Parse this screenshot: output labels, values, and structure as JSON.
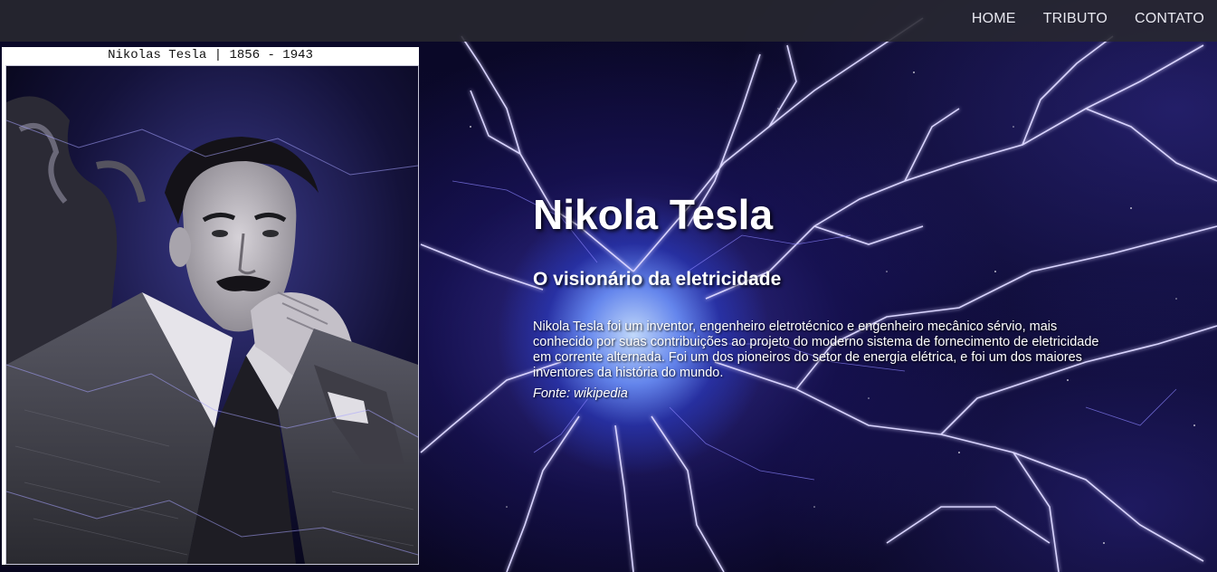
{
  "nav": {
    "items": [
      {
        "label": "HOME"
      },
      {
        "label": "TRIBUTO"
      },
      {
        "label": "CONTATO"
      }
    ]
  },
  "portrait": {
    "caption": "Nikolas Tesla | 1856 - 1943"
  },
  "hero": {
    "title": "Nikola Tesla",
    "subtitle": "O visionário da eletricidade",
    "description": "Nikola Tesla foi um inventor, engenheiro eletrotécnico e engenheiro mecânico sérvio, mais conhecido por suas contribuições ao projeto do moderno sistema de fornecimento de eletricidade em corrente alternada. Foi um dos pioneiros do setor de energia elétrica, e foi um dos maiores inventores da história do mundo.",
    "source": "Fonte: wikipedia"
  },
  "colors": {
    "nav_background": "#28282f",
    "text": "#ffffff",
    "lightning": "#c9c4ff",
    "plasma_core": "#9db8ff"
  },
  "icons": {
    "background": "plasma-lightning-image",
    "portrait": "tesla-portrait-image"
  }
}
